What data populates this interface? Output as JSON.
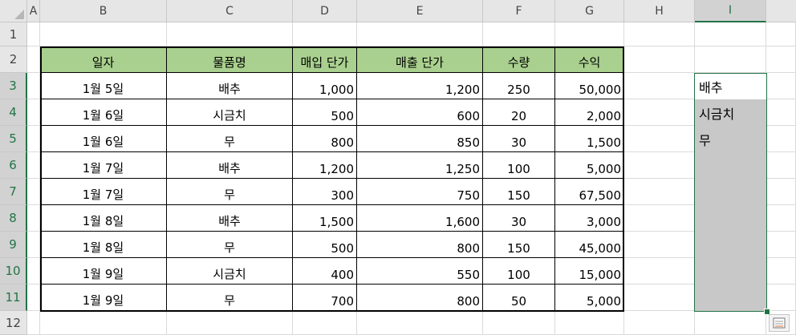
{
  "columns": [
    "A",
    "B",
    "C",
    "D",
    "E",
    "F",
    "G",
    "H",
    "I"
  ],
  "rows": [
    "1",
    "2",
    "3",
    "4",
    "5",
    "6",
    "7",
    "8",
    "9",
    "10",
    "11",
    "12"
  ],
  "table": {
    "headers": [
      "일자",
      "물품명",
      "매입 단가",
      "매출 단가",
      "수량",
      "수익"
    ],
    "rows": [
      [
        "1월 5일",
        "배추",
        "1,000",
        "1,200",
        "250",
        "50,000"
      ],
      [
        "1월 6일",
        "시금치",
        "500",
        "600",
        "20",
        "2,000"
      ],
      [
        "1월 6일",
        "무",
        "800",
        "850",
        "30",
        "1,500"
      ],
      [
        "1월 7일",
        "배추",
        "1,200",
        "1,250",
        "100",
        "5,000"
      ],
      [
        "1월 7일",
        "무",
        "300",
        "750",
        "150",
        "67,500"
      ],
      [
        "1월 8일",
        "배추",
        "1,500",
        "1,600",
        "30",
        "3,000"
      ],
      [
        "1월 8일",
        "무",
        "500",
        "800",
        "150",
        "45,000"
      ],
      [
        "1월 9일",
        "시금치",
        "400",
        "550",
        "100",
        "15,000"
      ],
      [
        "1월 9일",
        "무",
        "700",
        "800",
        "50",
        "5,000"
      ]
    ]
  },
  "unique_list": [
    "배추",
    "시금치",
    "무"
  ],
  "colors": {
    "header_fill": "#a9d08e",
    "selection_border": "#217346",
    "selection_fill": "#c8c8c8"
  },
  "icons": {
    "select_all": "triangle",
    "quick_analysis": "quick-analysis-icon"
  }
}
